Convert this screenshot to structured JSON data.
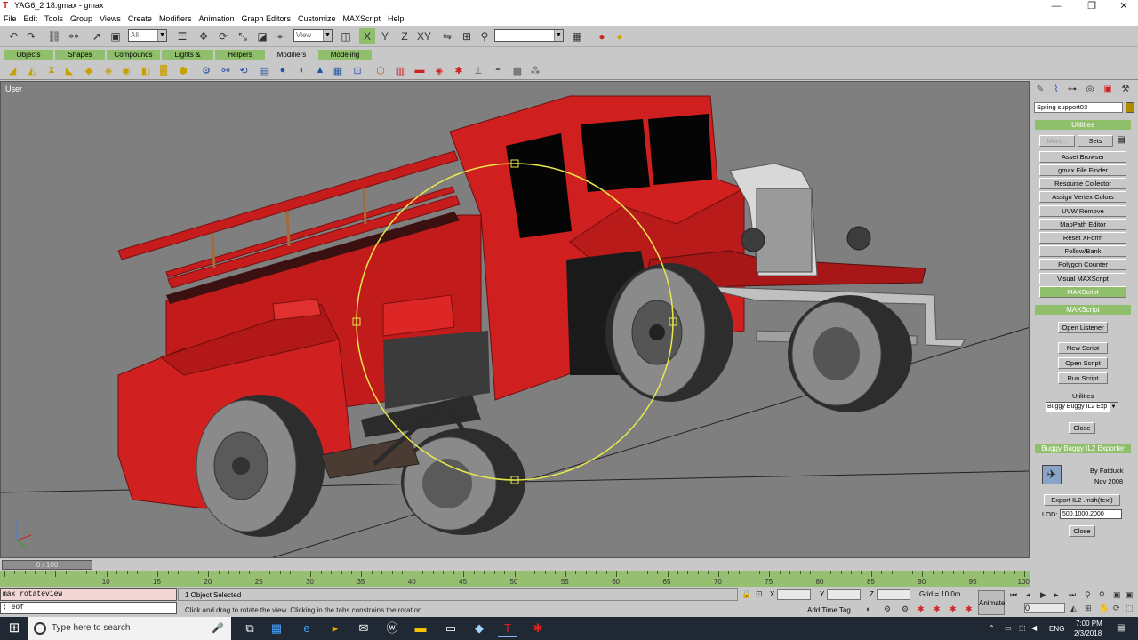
{
  "window": {
    "title": "YAG6_2 18.gmax - gmax",
    "minimize": "—",
    "restore": "❐",
    "close": "✕"
  },
  "menu": [
    "File",
    "Edit",
    "Tools",
    "Group",
    "Views",
    "Create",
    "Modifiers",
    "Animation",
    "Graph Editors",
    "Customize",
    "MAXScript",
    "Help"
  ],
  "toolbar": {
    "selection_filter": "All",
    "ref_coord": "View"
  },
  "tabs": [
    "Objects",
    "Shapes",
    "Compounds",
    "Lights & Cameras",
    "Helpers",
    "Modifiers",
    "Modeling"
  ],
  "active_tab": "Modifiers",
  "viewport": {
    "label": "User"
  },
  "command_panel": {
    "object_name": "Spring support03",
    "utilities_header": "Utilities",
    "more_button": "More...",
    "sets_button": "Sets",
    "utilities": [
      "Asset Browser",
      "gmax File Finder",
      "Resource Collector",
      "Assign Vertex Colors",
      "UVW Remove",
      "MapPath Editor",
      "Reset XForm",
      "Follow/Bank",
      "Polygon Counter",
      "Visual MAXScript",
      "MAXScript"
    ],
    "active_utility": "MAXScript",
    "maxscript_header": "MAXScript",
    "open_listener": "Open Listener",
    "new_script": "New Script",
    "open_script": "Open Script",
    "run_script": "Run Script",
    "utilities_label": "Utilities",
    "utilities_dropdown": "Buggy Buggy IL2 Exp",
    "close_button": "Close",
    "exporter_header": "Buggy Buggy IL2 Exporter",
    "exporter_by": "By Fatduck",
    "exporter_date": "Nov 2008",
    "export_button": "Export IL2 .msh(text)",
    "lod_label": "LOD:",
    "lod_value": "500,1000,2000",
    "exporter_close": "Close"
  },
  "timeline": {
    "slider": "0 / 100",
    "ticks": [
      "10",
      "15",
      "20",
      "25",
      "30",
      "35",
      "40",
      "45",
      "50",
      "55",
      "60",
      "65",
      "70",
      "75",
      "80",
      "85",
      "90",
      "95",
      "100"
    ]
  },
  "status": {
    "maxscript_line1": "max rotateview",
    "maxscript_line2": "; eof",
    "selection": "1 Object Selected",
    "prompt": "Click and drag to rotate the view.  Clicking in the tabs constrains the rotation.",
    "x_label": "X",
    "y_label": "Y",
    "z_label": "Z",
    "grid": "Grid = 10.0m",
    "add_time_tag": "Add Time Tag",
    "animate": "Animate",
    "frame": "0"
  },
  "taskbar": {
    "search_placeholder": "Type here to search",
    "time": "7:00 PM",
    "date": "2/3/2018",
    "language": "ENG"
  }
}
